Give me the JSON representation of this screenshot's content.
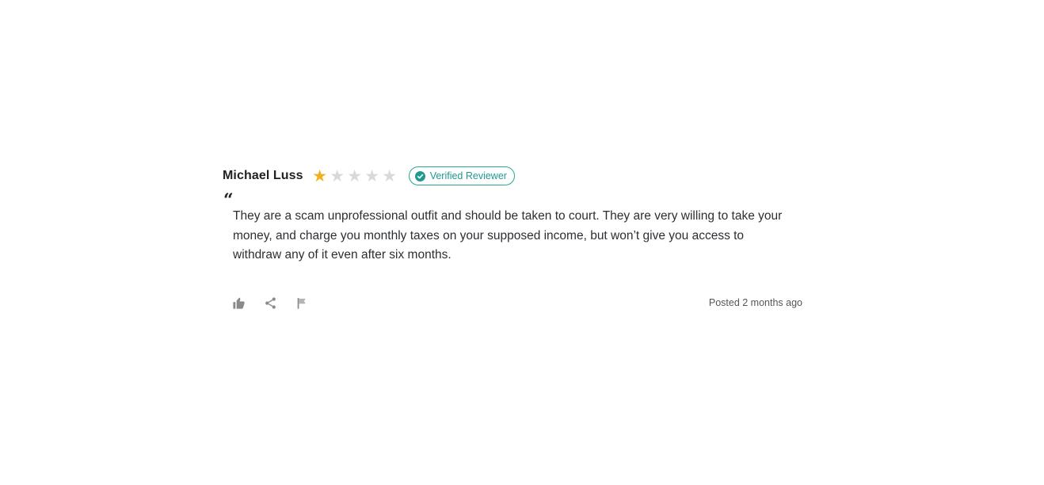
{
  "review": {
    "author": "Michael Luss",
    "rating": 1,
    "max_rating": 5,
    "badge_label": "Verified Reviewer",
    "quote_mark": "“",
    "text": "They are a scam unprofessional outfit and should be taken to court. They are very willing to take your money, and charge you monthly taxes on your supposed income, but won’t give you access to withdraw any of it even after six months.",
    "posted": "Posted 2 months ago"
  },
  "colors": {
    "star_filled": "#f2b01e",
    "star_empty": "#d9d9d9",
    "badge": "#2aa59a",
    "icon": "#8a8a8a"
  },
  "icons": [
    "check-circle-icon",
    "thumbs-up-icon",
    "share-icon",
    "flag-icon",
    "star-icon"
  ]
}
